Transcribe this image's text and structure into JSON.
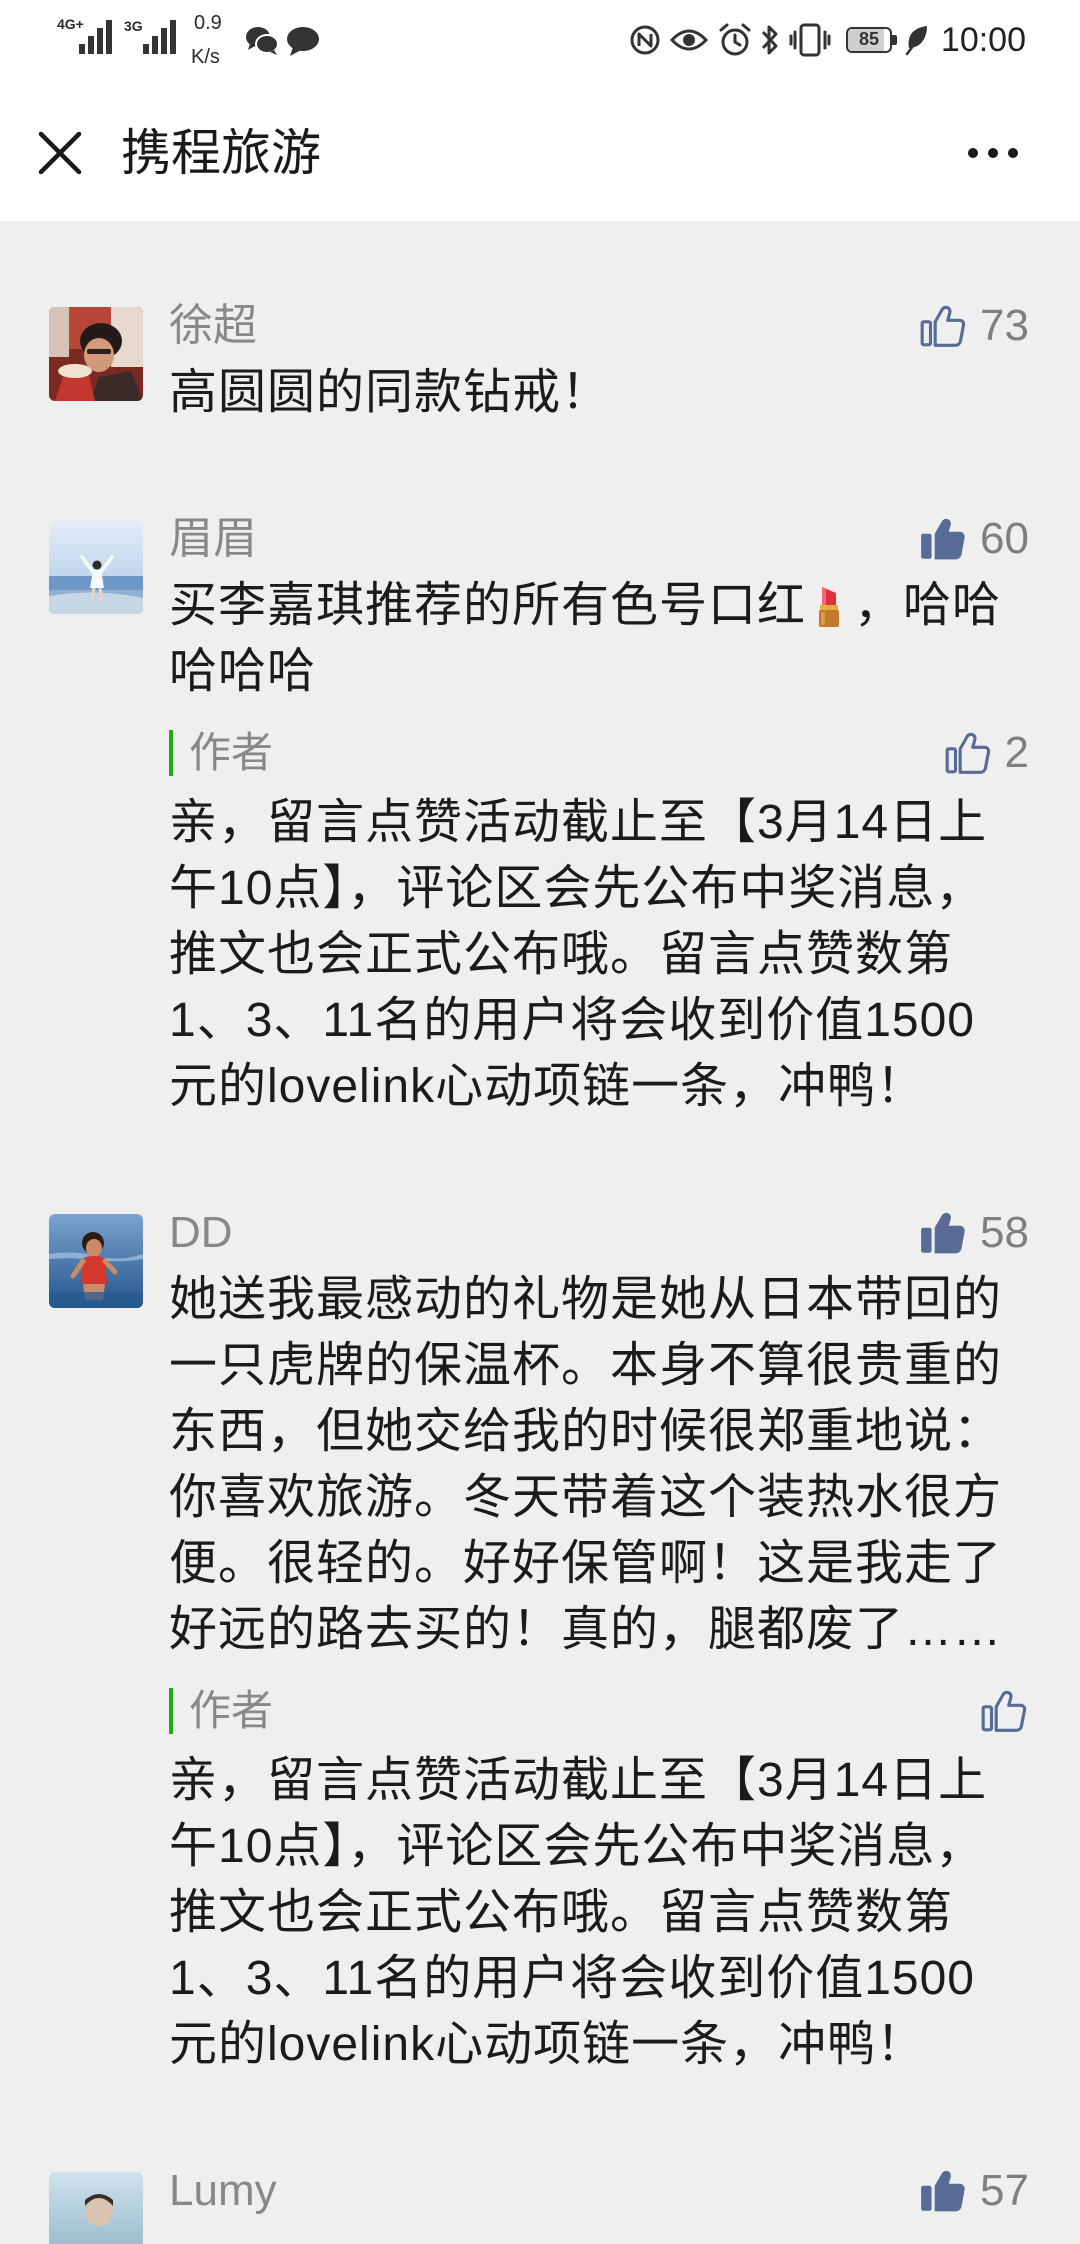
{
  "status_bar": {
    "network_1": "4G+",
    "network_2": "3G",
    "speed_value": "0.9",
    "speed_unit": "K/s",
    "battery_level": "85",
    "time": "10:00",
    "left_icons": [
      "signal-icon",
      "signal-icon",
      "wechat-icon",
      "message-icon"
    ],
    "right_icons": [
      "nfc-icon",
      "eye-comfort-icon",
      "alarm-icon",
      "bluetooth-icon",
      "vibrate-icon",
      "battery-icon",
      "power-saving-leaf-icon"
    ]
  },
  "header": {
    "close_icon": "close-icon",
    "title": "携程旅游",
    "more_icon": "more-icon"
  },
  "colors": {
    "page_background": "#efefef",
    "header_background": "#ffffff",
    "like_icon": "#576b95",
    "author_marker": "#1aad19",
    "primary_text": "#1b1b1b",
    "secondary_text": "#888888"
  },
  "comments": [
    {
      "name": "徐超",
      "like_icon": "thumbs-up-outline-icon",
      "liked": false,
      "likes": "73",
      "lines": [
        "高圆圆的同款钻戒！"
      ]
    },
    {
      "name": "眉眉",
      "like_icon": "thumbs-up-filled-icon",
      "liked": true,
      "likes": "60",
      "lines": [
        {
          "text": "买李嘉琪推荐的所有色号口红",
          "emoji_icon": "lipstick-emoji-icon",
          "text_after_emoji": "，哈哈"
        },
        {
          "text": "哈哈哈"
        }
      ],
      "author_reply": {
        "label": "作者",
        "like_icon": "thumbs-up-outline-icon",
        "liked": false,
        "likes": "2",
        "lines": [
          "亲，留言点赞活动截止至【3月14日上",
          "午10点】，评论区会先公布中奖消息，",
          "推文也会正式公布哦。留言点赞数第",
          "1、3、11名的用户将会收到价值1500",
          "元的lovelink心动项链一条，冲鸭！"
        ]
      }
    },
    {
      "name": "DD",
      "like_icon": "thumbs-up-filled-icon",
      "liked": true,
      "likes": "58",
      "lines": [
        "她送我最感动的礼物是她从日本带回的",
        "一只虎牌的保温杯。本身不算很贵重的",
        "东西，但她交给我的时候很郑重地说：",
        "你喜欢旅游。冬天带着这个装热水很方",
        "便。很轻的。好好保管啊！这是我走了",
        "好远的路去买的！真的，腿都废了……"
      ],
      "author_reply": {
        "label": "作者",
        "like_icon": "thumbs-up-outline-icon",
        "liked": false,
        "lines": [
          "亲，留言点赞活动截止至【3月14日上",
          "午10点】，评论区会先公布中奖消息，",
          "推文也会正式公布哦。留言点赞数第",
          "1、3、11名的用户将会收到价值1500",
          "元的lovelink心动项链一条，冲鸭！"
        ]
      }
    },
    {
      "name": "Lumy",
      "like_icon": "thumbs-up-filled-icon",
      "liked": true,
      "likes": "57"
    }
  ]
}
